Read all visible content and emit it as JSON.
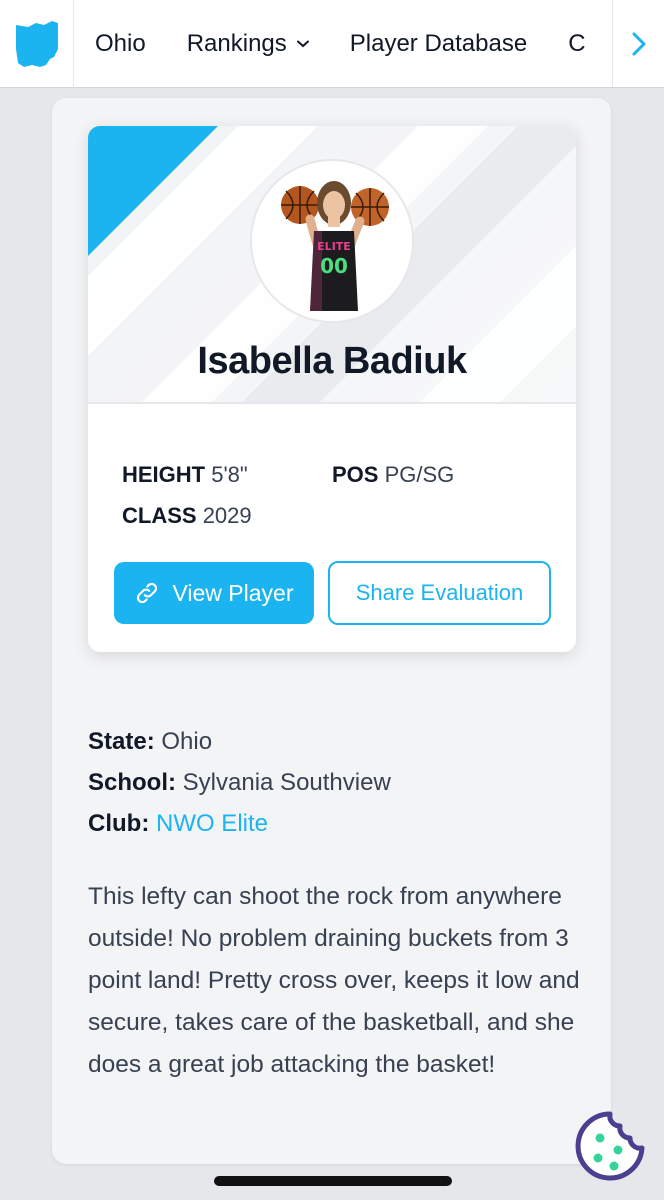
{
  "nav": {
    "items": [
      {
        "label": "Ohio"
      },
      {
        "label": "Rankings"
      },
      {
        "label": "Player Database"
      },
      {
        "label": "C"
      }
    ],
    "logo_icon": "ohio-state-shape-icon",
    "next_icon": "chevron-right-icon"
  },
  "player": {
    "name": "Isabella Badiuk",
    "jersey_text": "ELITE",
    "jersey_number": "00",
    "height_label": "HEIGHT",
    "height_value": "5'8\"",
    "pos_label": "POS",
    "pos_value": "PG/SG",
    "class_label": "CLASS",
    "class_value": "2029"
  },
  "buttons": {
    "view_player": "View Player",
    "share_evaluation": "Share Evaluation"
  },
  "info": {
    "state_label": "State:",
    "state_value": "Ohio",
    "school_label": "School:",
    "school_value": "Sylvania Southview",
    "club_label": "Club:",
    "club_value": "NWO Elite"
  },
  "description": "This lefty can shoot the rock from anywhere outside! No problem draining buckets from 3 point land! Pretty cross over, keeps it low and secure, takes care of the basketball, and she does a great job attacking the basket!",
  "colors": {
    "accent": "#1bb4f1",
    "nav_bg": "#ffffff",
    "page_bg": "#e5e7eb",
    "card_bg": "#f3f4f6",
    "cookie_accent": "#4b3f8f",
    "cookie_dots": "#34d399"
  }
}
